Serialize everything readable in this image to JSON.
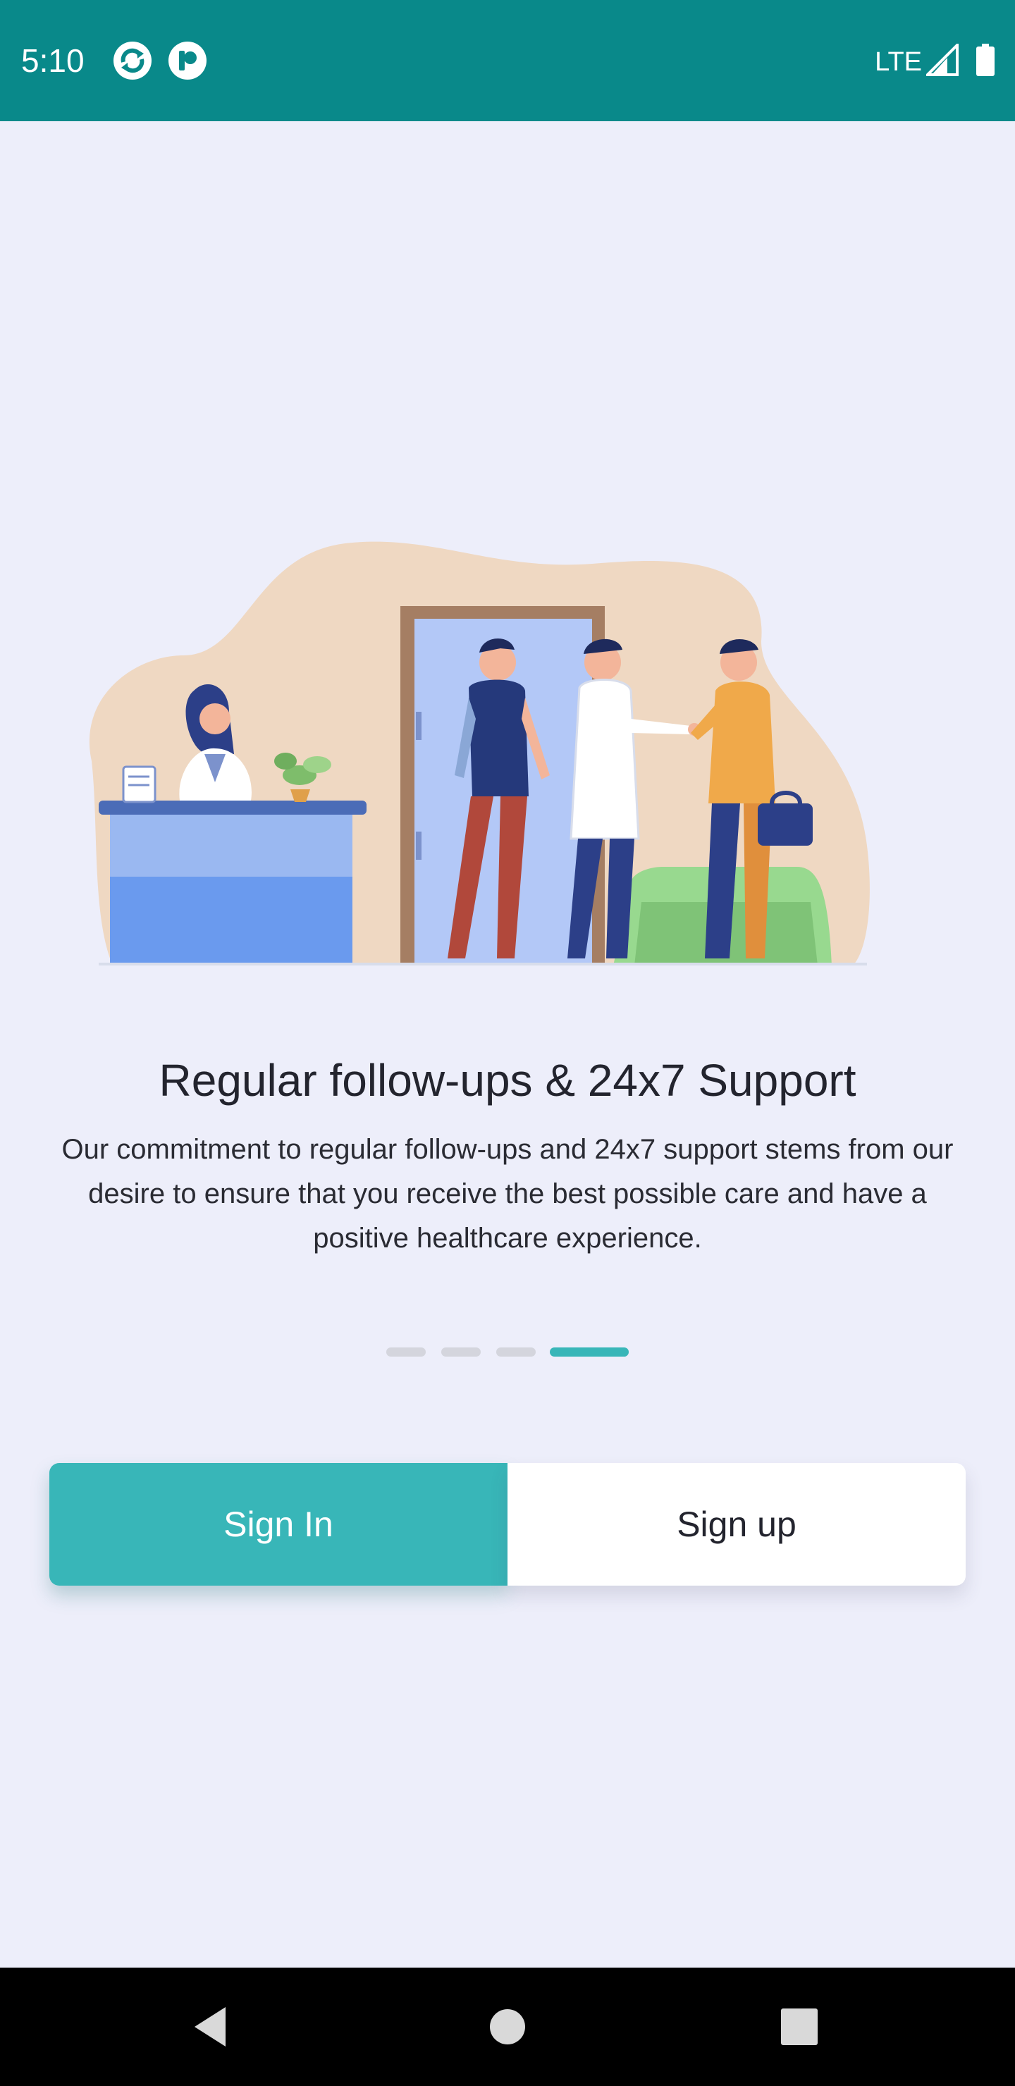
{
  "status_bar": {
    "time": "5:10",
    "network": "LTE",
    "background_color": "#09898A",
    "icons": [
      "sync-app-icon",
      "app-badge-icon",
      "signal-icon",
      "battery-icon"
    ]
  },
  "onboarding": {
    "illustration": "clinic-reception-illustration",
    "title": "Regular follow-ups & 24x7 Support",
    "description": "Our commitment to regular follow-ups and 24x7 support stems from our desire to ensure that you receive the best possible care and have a positive healthcare experience.",
    "page_count": 4,
    "current_page": 4
  },
  "actions": {
    "sign_in_label": "Sign In",
    "sign_up_label": "Sign up"
  },
  "nav_bar": {
    "icons": [
      "back-icon",
      "home-icon",
      "recents-icon"
    ]
  },
  "colors": {
    "accent": "#38B6B8",
    "background": "#EDEEFA",
    "text": "#23242E"
  }
}
